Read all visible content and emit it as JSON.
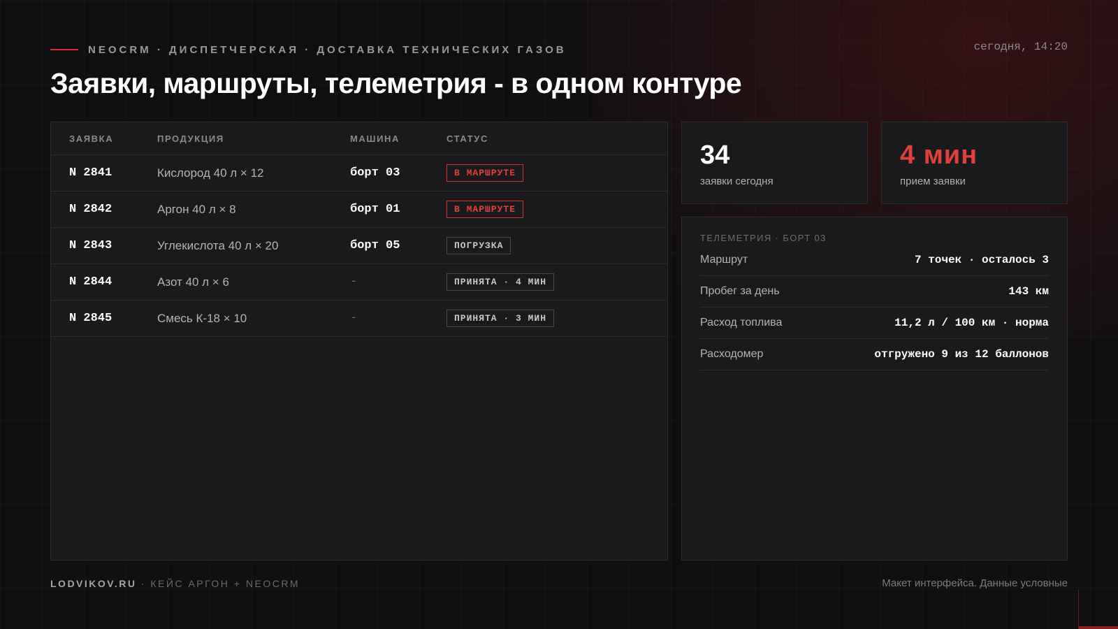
{
  "header": {
    "eyebrow": "NEOCRM · ДИСПЕТЧЕРСКАЯ · ДОСТАВКА ТЕХНИЧЕСКИХ ГАЗОВ",
    "clock": "сегодня, 14:20",
    "title": "Заявки, маршруты, телеметрия - в одном контуре"
  },
  "orders": {
    "columns": [
      "ЗАЯВКА",
      "ПРОДУКЦИЯ",
      "МАШИНА",
      "СТАТУС"
    ],
    "rows": [
      {
        "id": "N 2841",
        "product": "Кислород 40 л × 12",
        "vehicle": "борт 03",
        "status": "В МАРШРУТЕ"
      },
      {
        "id": "N 2842",
        "product": "Аргон 40 л × 8",
        "vehicle": "борт 01",
        "status": "В МАРШРУТЕ"
      },
      {
        "id": "N 2843",
        "product": "Углекислота 40 л × 20",
        "vehicle": "борт 05",
        "status": "ПОГРУЗКА"
      },
      {
        "id": "N 2844",
        "product": "Азот 40 л × 6",
        "vehicle": "-",
        "status": "ПРИНЯТА · 4 МИН"
      },
      {
        "id": "N 2845",
        "product": "Смесь К-18 × 10",
        "vehicle": "-",
        "status": "ПРИНЯТА · 3 МИН"
      }
    ]
  },
  "kpis": {
    "orders_today": {
      "value": "34",
      "label": "заявки сегодня"
    },
    "intake_time": {
      "value": "4 мин",
      "label": "прием заявки"
    }
  },
  "telemetry": {
    "title": "ТЕЛЕМЕТРИЯ · БОРТ 03",
    "rows": [
      {
        "label": "Маршрут",
        "value": "7 точек · осталось 3"
      },
      {
        "label": "Пробег за день",
        "value": "143 км"
      },
      {
        "label": "Расход топлива",
        "value": "11,2 л / 100 км · норма"
      },
      {
        "label": "Расходомер",
        "value": "отгружено 9 из 12 баллонов"
      }
    ]
  },
  "footer": {
    "brand": "LODVIKOV.RU",
    "subtitle": " · КЕЙС АРГОН + NEOCRM",
    "disclaimer": "Макет интерфейса. Данные условные"
  },
  "colors": {
    "accent": "#d7322f",
    "background": "#0f0f11",
    "panel": "#1a1a1c"
  }
}
